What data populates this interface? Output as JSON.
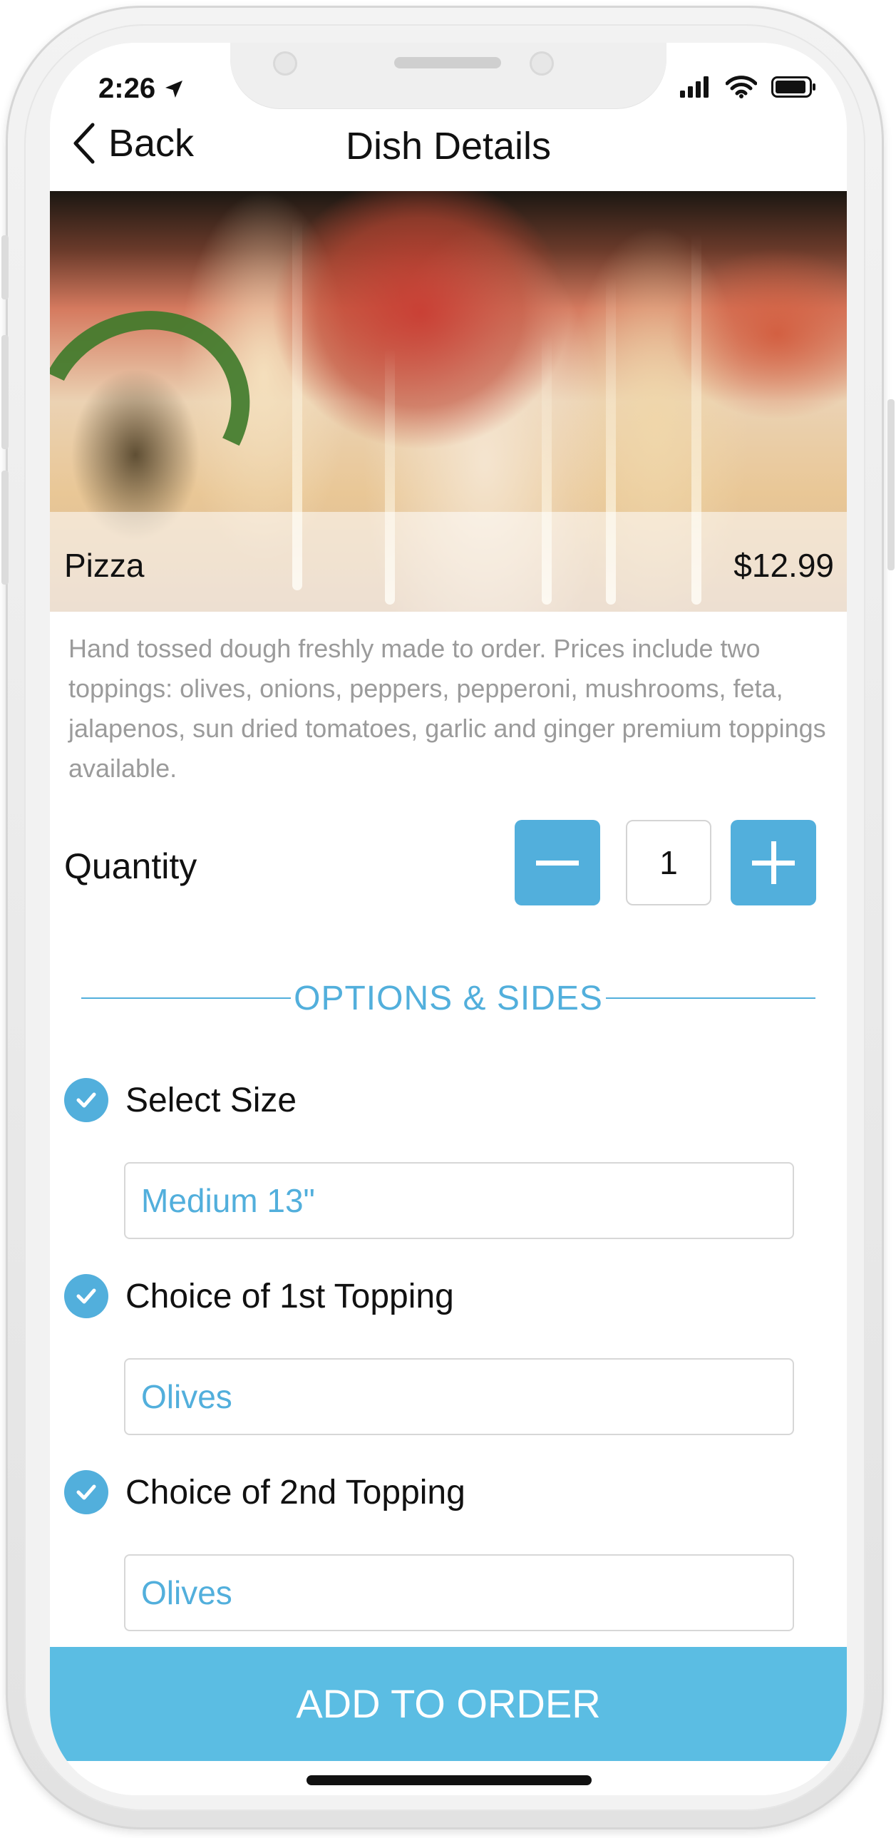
{
  "status_bar": {
    "time": "2:26",
    "icons": [
      "location-arrow-icon",
      "cellular-signal-icon",
      "wifi-icon",
      "battery-icon"
    ]
  },
  "nav": {
    "back_label": "Back",
    "title": "Dish Details"
  },
  "dish": {
    "name": "Pizza",
    "price": "$12.99",
    "description": "Hand tossed dough freshly made to order. Prices include two toppings: olives, onions, peppers, pepperoni, mushrooms, feta, jalapenos, sun dried tomatoes, garlic and ginger premium toppings available."
  },
  "quantity": {
    "label": "Quantity",
    "value": "1"
  },
  "options": {
    "section_title": "OPTIONS & SIDES",
    "items": [
      {
        "label": "Select Size",
        "selected": "Medium 13\""
      },
      {
        "label": "Choice of 1st Topping",
        "selected": "Olives"
      },
      {
        "label": "Choice of 2nd Topping",
        "selected": "Olives"
      }
    ]
  },
  "cta": {
    "label": "ADD TO ORDER"
  },
  "colors": {
    "accent": "#52afdc",
    "cta": "#5bbde3",
    "description_text": "#9b9b9b"
  }
}
